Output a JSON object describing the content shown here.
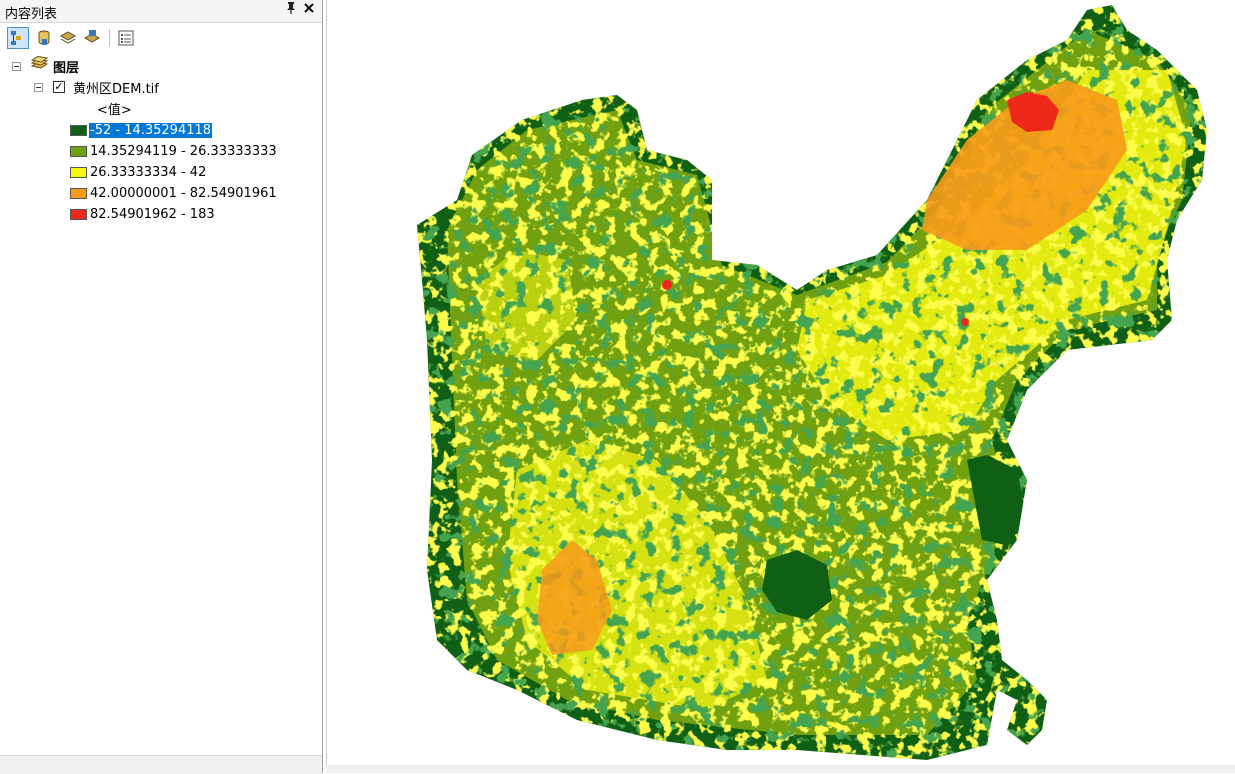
{
  "toc": {
    "title": "内容列表",
    "pin_glyph": "ₚ",
    "close_glyph": "✕",
    "toolbar": {
      "buttons": [
        {
          "name": "list-by-drawing-order",
          "active": true
        },
        {
          "name": "list-by-source",
          "active": false
        },
        {
          "name": "list-by-visibility",
          "active": false
        },
        {
          "name": "list-by-selection",
          "active": false
        },
        {
          "name": "options",
          "active": false
        }
      ]
    },
    "tree": {
      "group_label": "图层",
      "layer": {
        "name": "黄州区DEM.tif",
        "checked": true,
        "field_label": "<值>",
        "classes": [
          {
            "label": "-52 - 14.35294118",
            "color": "#0f5f14",
            "selected": true
          },
          {
            "label": "14.35294119 - 26.33333333",
            "color": "#71a011",
            "selected": false
          },
          {
            "label": "26.33333334 - 42",
            "color": "#f7f711",
            "selected": false
          },
          {
            "label": "42.00000001 - 82.54901961",
            "color": "#f79a18",
            "selected": false
          },
          {
            "label": "82.54901962 - 183",
            "color": "#ee2818",
            "selected": false
          }
        ]
      }
    }
  },
  "map": {
    "colors": {
      "low": "#0f5f14",
      "midlow": "#71a011",
      "mid": "#f7f711",
      "high": "#f79a18",
      "peak": "#ee2818"
    }
  }
}
